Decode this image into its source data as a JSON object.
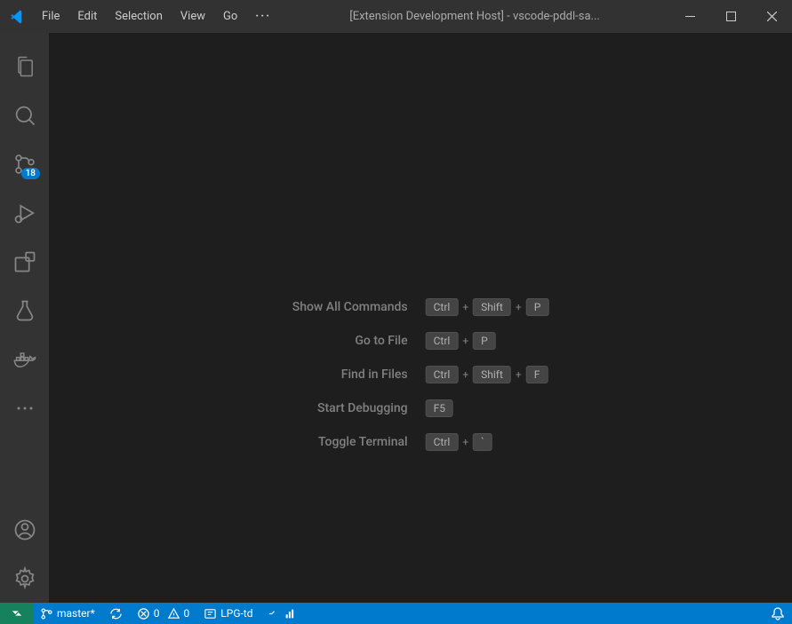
{
  "titlebar": {
    "menus": [
      "File",
      "Edit",
      "Selection",
      "View",
      "Go"
    ],
    "title": "[Extension Development Host] - vscode-pddl-sa..."
  },
  "activityBar": {
    "scmBadge": "18"
  },
  "shortcuts": [
    {
      "label": "Show All Commands",
      "keys": [
        "Ctrl",
        "+",
        "Shift",
        "+",
        "P"
      ]
    },
    {
      "label": "Go to File",
      "keys": [
        "Ctrl",
        "+",
        "P"
      ]
    },
    {
      "label": "Find in Files",
      "keys": [
        "Ctrl",
        "+",
        "Shift",
        "+",
        "F"
      ]
    },
    {
      "label": "Start Debugging",
      "keys": [
        "F5"
      ]
    },
    {
      "label": "Toggle Terminal",
      "keys": [
        "Ctrl",
        "+",
        "`"
      ]
    }
  ],
  "statusBar": {
    "branch": "master*",
    "errors": "0",
    "warnings": "0",
    "planner": "LPG-td"
  }
}
